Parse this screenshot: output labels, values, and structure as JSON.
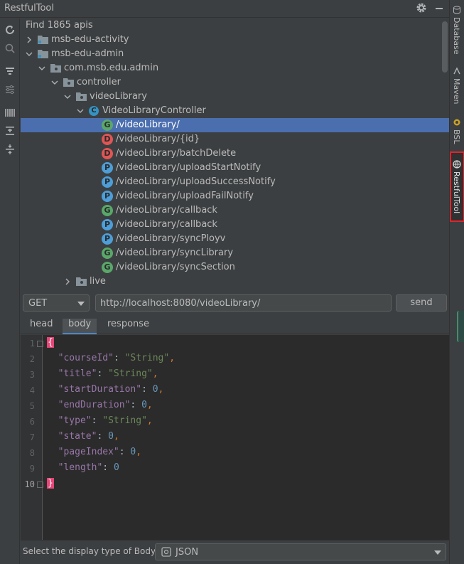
{
  "window": {
    "title": "RestfulTool"
  },
  "tree": {
    "header": "Find 1865 apis",
    "rows": [
      {
        "label": "msb-edu-activity"
      },
      {
        "label": "msb-edu-admin"
      },
      {
        "label": "com.msb.edu.admin"
      },
      {
        "label": "controller"
      },
      {
        "label": "videoLibrary"
      },
      {
        "label": "VideoLibraryController",
        "badge": "C"
      },
      {
        "label": "/videoLibrary/",
        "badge": "G"
      },
      {
        "label": "/videoLibrary/{id}",
        "badge": "D"
      },
      {
        "label": "/videoLibrary/batchDelete",
        "badge": "D"
      },
      {
        "label": "/videoLibrary/uploadStartNotify",
        "badge": "P"
      },
      {
        "label": "/videoLibrary/uploadSuccessNotify",
        "badge": "P"
      },
      {
        "label": "/videoLibrary/uploadFailNotify",
        "badge": "P"
      },
      {
        "label": "/videoLibrary/callback",
        "badge": "G"
      },
      {
        "label": "/videoLibrary/callback",
        "badge": "P"
      },
      {
        "label": "/videoLibrary/syncPloyv",
        "badge": "P"
      },
      {
        "label": "/videoLibrary/syncLibrary",
        "badge": "G"
      },
      {
        "label": "/videoLibrary/syncSection",
        "badge": "G"
      },
      {
        "label": "live"
      }
    ]
  },
  "request": {
    "method": "GET",
    "url": "http://localhost:8080/videoLibrary/",
    "send_label": "send"
  },
  "tabs": {
    "head": "head",
    "body": "body",
    "response": "response"
  },
  "editor": {
    "line_numbers": [
      "1",
      "2",
      "3",
      "4",
      "5",
      "6",
      "7",
      "8",
      "9",
      "10"
    ],
    "open_brace": "{",
    "close_brace": "}",
    "fields": [
      {
        "key": "\"courseId\"",
        "value": "\"String\"",
        "comma": ","
      },
      {
        "key": "\"title\"",
        "value": "\"String\"",
        "comma": ","
      },
      {
        "key": "\"startDuration\"",
        "value": "0",
        "comma": ","
      },
      {
        "key": "\"endDuration\"",
        "value": "0",
        "comma": ","
      },
      {
        "key": "\"type\"",
        "value": "\"String\"",
        "comma": ","
      },
      {
        "key": "\"state\"",
        "value": "0",
        "comma": ","
      },
      {
        "key": "\"pageIndex\"",
        "value": "0",
        "comma": ","
      },
      {
        "key": "\"length\"",
        "value": "0",
        "comma": ""
      }
    ]
  },
  "footer": {
    "label": "Select the display type of Body:",
    "type": "JSON"
  },
  "right_strip": {
    "database": "Database",
    "maven": "Maven",
    "bsl": "BSL",
    "restfultool": "RestfulTool"
  },
  "colors": {
    "selection": "#4b6eaf",
    "get_badge": "#59a869",
    "delete_badge": "#e05555",
    "post_badge": "#4d9ed8",
    "highlight_border": "#e0242b"
  }
}
